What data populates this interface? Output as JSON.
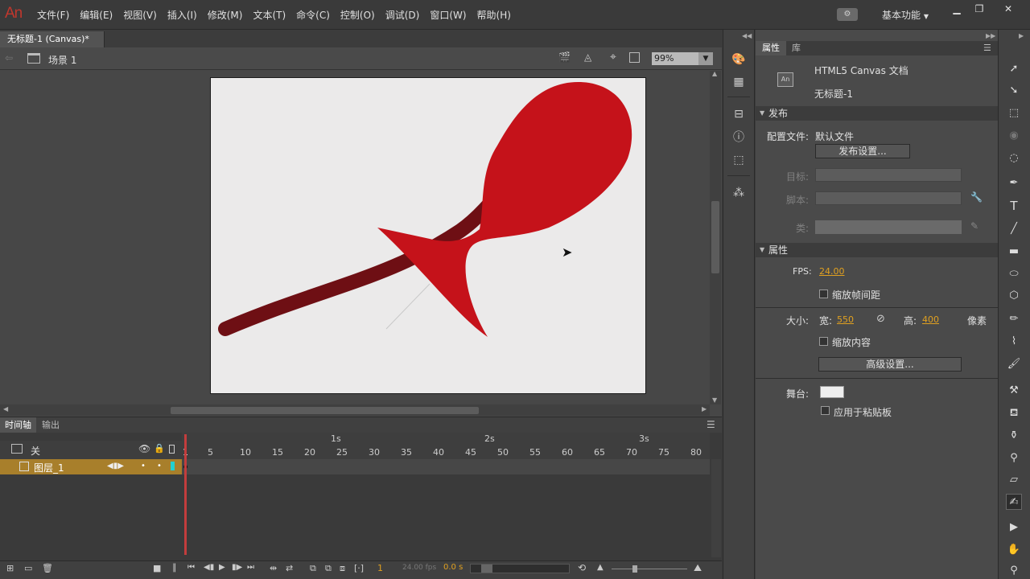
{
  "app": {
    "logo": "An"
  },
  "menu": [
    "文件(F)",
    "编辑(E)",
    "视图(V)",
    "插入(I)",
    "修改(M)",
    "文本(T)",
    "命令(C)",
    "控制(O)",
    "调试(D)",
    "窗口(W)",
    "帮助(H)"
  ],
  "workspace": {
    "label": "基本功能"
  },
  "window": {
    "minimize": "▁",
    "restore": "❐",
    "close": "✕"
  },
  "document": {
    "tab_title": "无标题-1 (Canvas)*",
    "close": "×"
  },
  "editbar": {
    "scene": "场景 1",
    "zoom": "99%"
  },
  "timeline": {
    "tabs": [
      "时间轴",
      "输出"
    ],
    "layer_header": "关",
    "layer_name": "图层_1",
    "ruler_seconds": [
      "1s",
      "2s",
      "3s"
    ],
    "ruler_frames": [
      "1",
      "5",
      "10",
      "15",
      "20",
      "25",
      "30",
      "35",
      "40",
      "45",
      "50",
      "55",
      "60",
      "65",
      "70",
      "75",
      "80"
    ],
    "current_frame": "1",
    "fps_display": "24.00 fps",
    "time_display": "0.0 s"
  },
  "properties": {
    "tabs": [
      "属性",
      "库"
    ],
    "doc_type": "HTML5 Canvas 文档",
    "doc_icon": "An",
    "doc_name": "无标题-1",
    "publish_section": "发布",
    "profile_label": "配置文件:",
    "profile_value": "默认文件",
    "publish_settings_btn": "发布设置...",
    "target_label": "目标:",
    "script_label": "脚本:",
    "class_label": "类:",
    "props_section": "属性",
    "fps_label": "FPS:",
    "fps_value": "24.00",
    "scale_interval": "缩放帧间距",
    "size_label": "大小:",
    "width_label": "宽:",
    "width_value": "550",
    "height_label": "高:",
    "height_value": "400",
    "unit": "像素",
    "scale_content": "缩放内容",
    "advanced_btn": "高级设置...",
    "stage_label": "舞台:",
    "stage_color": "#eeeeee",
    "apply_clipboard": "应用于粘贴板"
  },
  "colors": {
    "accent_red": "#c5121a",
    "dark_red": "#6e0f14",
    "layer_highlight": "#a87f2b"
  }
}
